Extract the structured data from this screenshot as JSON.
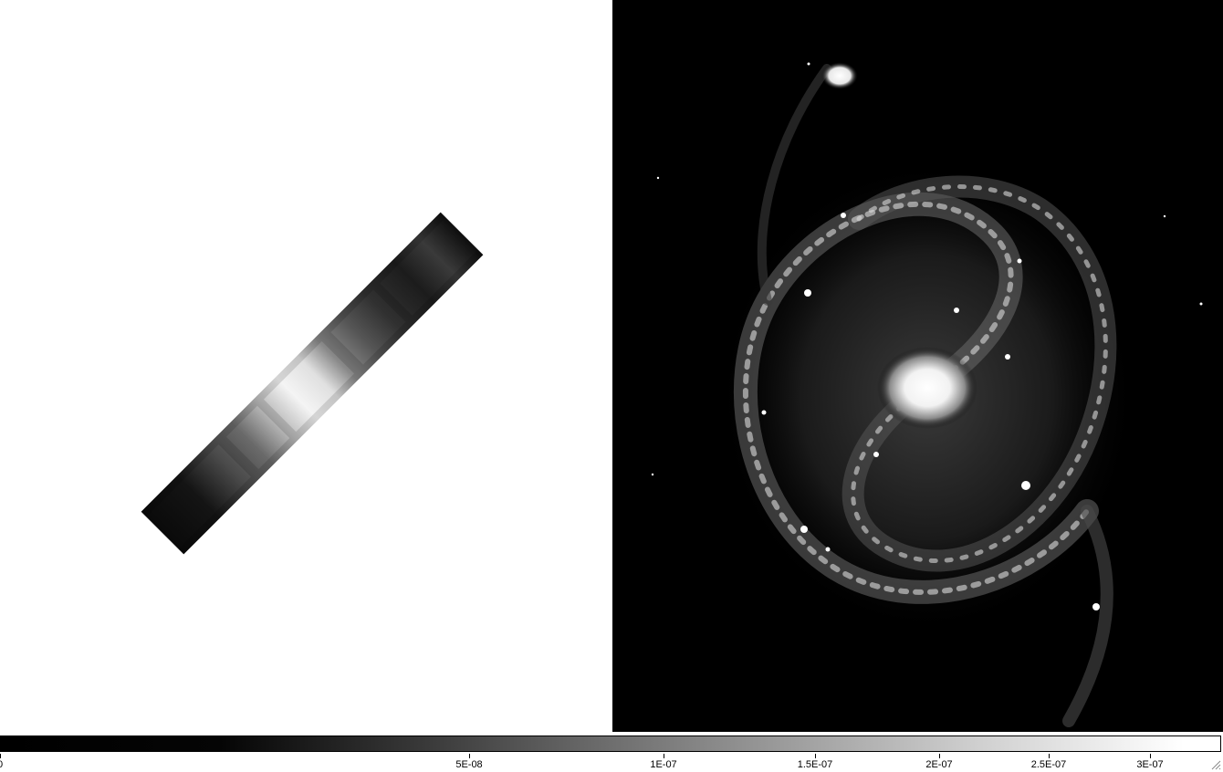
{
  "panels": {
    "left": {
      "name": "spectral-slit-frame",
      "background": "#ffffff"
    },
    "right": {
      "name": "galaxy-image-frame",
      "background": "#000000"
    }
  },
  "colorbar": {
    "colormap": "grey",
    "ticks": [
      {
        "label": "0",
        "value": 0
      },
      {
        "label": "5E-08",
        "value": 5e-08
      },
      {
        "label": "1E-07",
        "value": 1e-07
      },
      {
        "label": "1.5E-07",
        "value": 1.5e-07
      },
      {
        "label": "2E-07",
        "value": 2e-07
      },
      {
        "label": "2.5E-07",
        "value": 2.5e-07
      },
      {
        "label": "3E-07",
        "value": 3e-07
      }
    ]
  },
  "icons": {
    "resize": "resize-grip-icon"
  }
}
